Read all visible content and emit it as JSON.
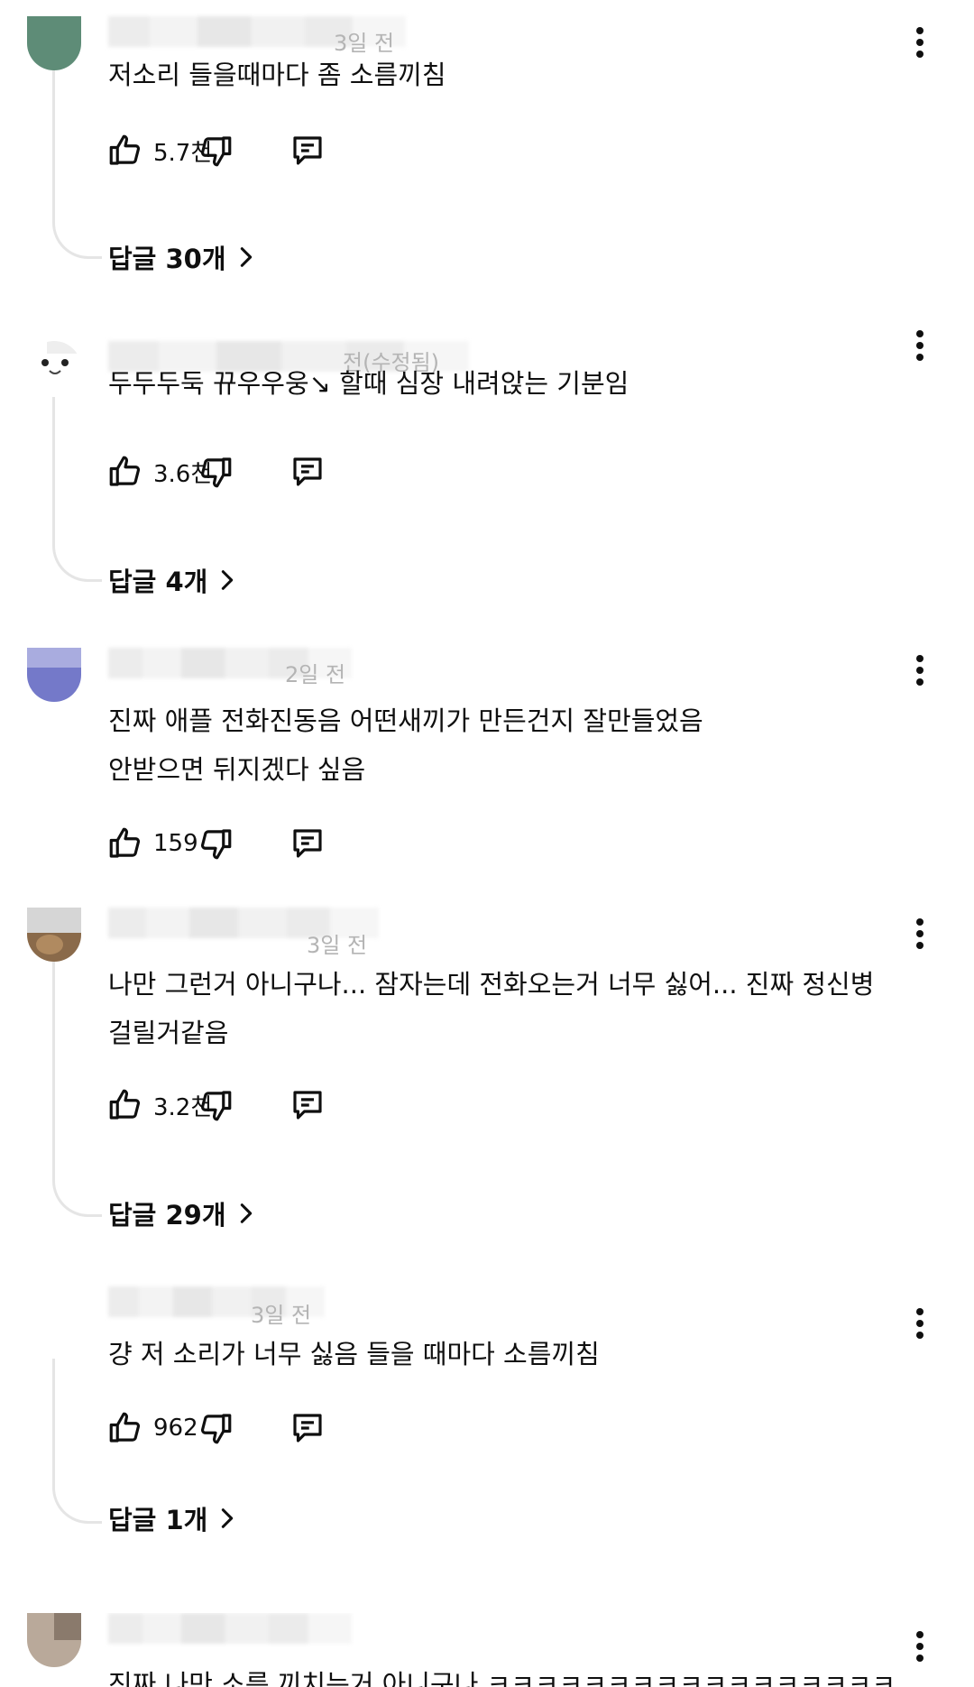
{
  "comments": [
    {
      "meta_visible": "3일 전",
      "text": "저소리 들을때마다 좀 소름끼침",
      "likes": "5.7천",
      "replies_label": "답글 30개",
      "avatar_color": "#5e8c77"
    },
    {
      "meta_visible": "전(수정됨)",
      "text": "두두두둑 뀨우우웅↘ 할때 심장 내려앉는 기분임",
      "likes": "3.6천",
      "replies_label": "답글 4개",
      "avatar_color": "#ffffff"
    },
    {
      "meta_visible": "2일 전",
      "text_line1": "진짜 애플 전화진동음 어떤새끼가 만든건지 잘만들었음",
      "text_line2": "안받으면 뒤지겠다 싶음",
      "likes": "159",
      "avatar_color": "#7479c9"
    },
    {
      "meta_visible": "3일 전",
      "text_line1": "나만 그런거 아니구나... 잠자는데 전화오는거 너무 싫어... 진짜 정신병",
      "text_line2": "걸릴거같음",
      "likes": "3.2천",
      "replies_label": "답글 29개",
      "avatar_color": "#8a6a4a"
    },
    {
      "meta_visible": "3일 전",
      "text": "걍 저 소리가 너무 싫음 들을 때마다 소름끼침",
      "likes": "962",
      "replies_label": "답글 1개",
      "avatar_color": "#c8b8a8"
    },
    {
      "text_peek": "진짜 나만 소름 끼치는거 아니구나 ㅋㅋㅋㅋㅋㅋㅋㅋㅋㅋㅋㅋㅋㅋㅋㅋㅋ",
      "avatar_color": "#b9a99a"
    }
  ],
  "icons": {
    "like": "thumbs-up-icon",
    "dislike": "thumbs-down-icon",
    "reply": "comment-icon",
    "more": "more-vert-icon",
    "chevron": "chevron-right-icon"
  },
  "colors": {
    "text": "#0f0f0f",
    "thread_line": "#e5e5e5",
    "muted": "#b4b4b4"
  }
}
